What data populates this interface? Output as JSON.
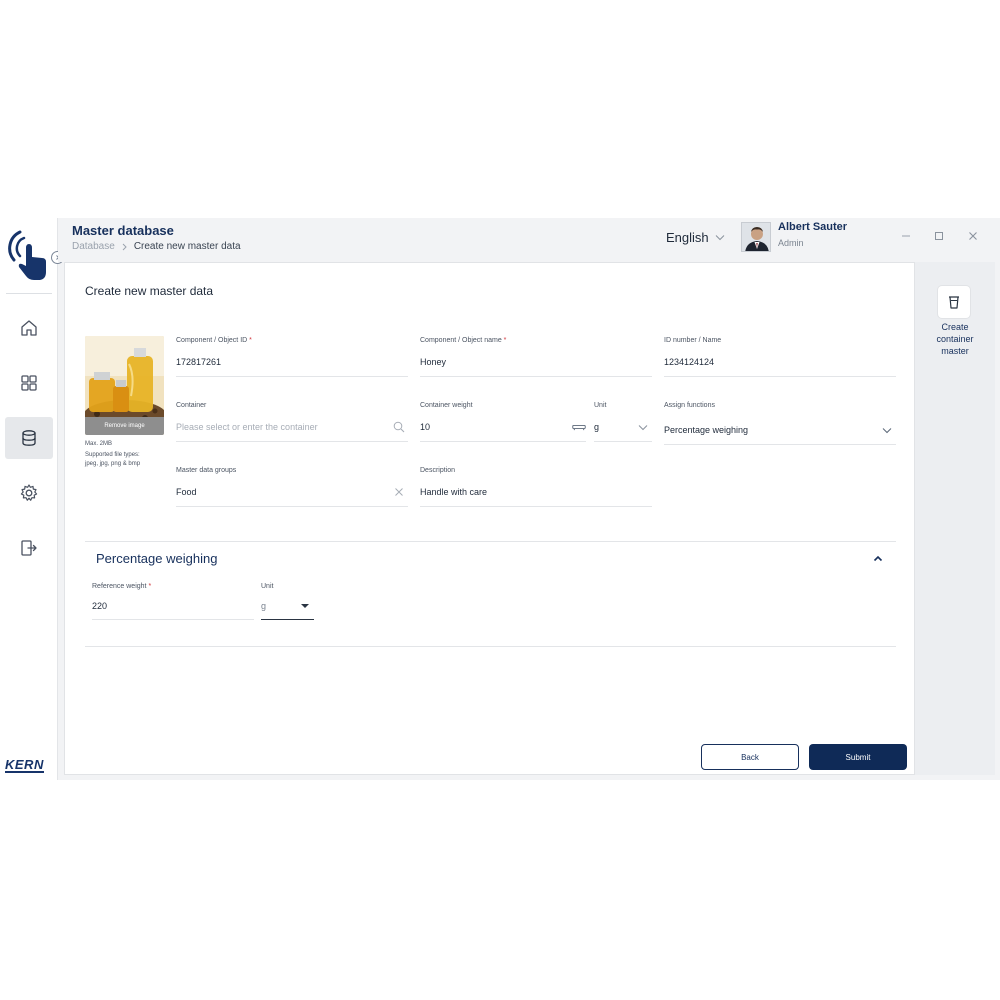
{
  "header": {
    "title": "Master database",
    "breadcrumb": [
      "Database",
      "Create new master data"
    ],
    "language": "English",
    "user_name": "Albert Sauter",
    "user_role": "Admin"
  },
  "sidebar": {
    "items": [
      {
        "icon": "home-icon",
        "active": false
      },
      {
        "icon": "grid-icon",
        "active": false
      },
      {
        "icon": "database-icon",
        "active": true
      },
      {
        "icon": "gear-icon",
        "active": false
      },
      {
        "icon": "logout-icon",
        "active": false
      }
    ],
    "brand": "KERN"
  },
  "form": {
    "title": "Create new master data",
    "image": {
      "remove_label": "Remove image",
      "hint_size": "Max. 2MB",
      "hint_types_line1": "Supported file types:",
      "hint_types_line2": "jpeg, jpg, png & bmp"
    },
    "component_id": {
      "label": "Component / Object ID",
      "required": "*",
      "value": "172817261"
    },
    "component_name": {
      "label": "Component / Object name",
      "required": "*",
      "value": "Honey"
    },
    "id_number": {
      "label": "ID number / Name",
      "value": "1234124124"
    },
    "container": {
      "label": "Container",
      "placeholder": "Please select or enter the container"
    },
    "container_weight": {
      "label": "Container weight",
      "value": "10"
    },
    "unit": {
      "label": "Unit",
      "value": "g"
    },
    "assign_functions": {
      "label": "Assign functions",
      "value": "Percentage weighing"
    },
    "master_data_groups": {
      "label": "Master data groups",
      "value": "Food"
    },
    "description": {
      "label": "Description",
      "value": "Handle with care"
    }
  },
  "percentage_section": {
    "title": "Percentage weighing",
    "reference_weight": {
      "label": "Reference weight",
      "required": "*",
      "value": "220"
    },
    "unit": {
      "label": "Unit",
      "value": "g"
    }
  },
  "actions": {
    "back": "Back",
    "submit": "Submit"
  },
  "right_panel": {
    "label_line1": "Create",
    "label_line2": "container",
    "label_line3": "master"
  },
  "colors": {
    "brand_navy": "#0f2a57",
    "required_red": "#d0343a",
    "active_nav_bg": "#e6e8eb"
  }
}
